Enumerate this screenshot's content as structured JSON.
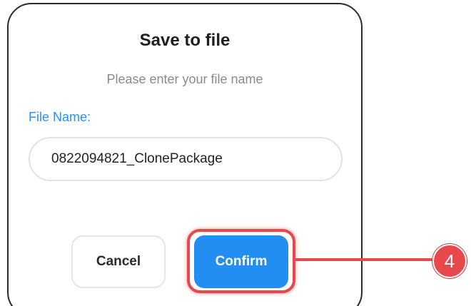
{
  "dialog": {
    "title": "Save to file",
    "subtitle": "Please enter your file name",
    "field_label": "File Name:",
    "file_name_value": "0822094821_ClonePackage",
    "cancel_label": "Cancel",
    "confirm_label": "Confirm"
  },
  "annotation": {
    "step_number": "4"
  },
  "colors": {
    "accent": "#238ef2",
    "label_blue": "#2f8ff0",
    "highlight_red": "#e8474b"
  }
}
